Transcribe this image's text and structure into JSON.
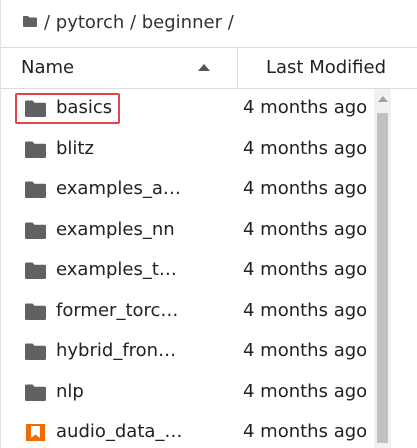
{
  "breadcrumb": {
    "path": "/ pytorch / beginner /"
  },
  "columns": {
    "name": "Name",
    "modified": "Last Modified"
  },
  "files": [
    {
      "name": "basics",
      "modified": "4 months ago",
      "type": "folder"
    },
    {
      "name": "blitz",
      "modified": "4 months ago",
      "type": "folder"
    },
    {
      "name": "examples_a…",
      "modified": "4 months ago",
      "type": "folder"
    },
    {
      "name": "examples_nn",
      "modified": "4 months ago",
      "type": "folder"
    },
    {
      "name": "examples_t…",
      "modified": "4 months ago",
      "type": "folder"
    },
    {
      "name": "former_torc…",
      "modified": "4 months ago",
      "type": "folder"
    },
    {
      "name": "hybrid_fron…",
      "modified": "4 months ago",
      "type": "folder"
    },
    {
      "name": "nlp",
      "modified": "4 months ago",
      "type": "folder"
    },
    {
      "name": "audio_data_…",
      "modified": "4 months ago",
      "type": "notebook"
    }
  ],
  "colors": {
    "folder_icon": "#616161",
    "notebook_icon": "#ef6c00",
    "highlight": "#e0464c"
  }
}
